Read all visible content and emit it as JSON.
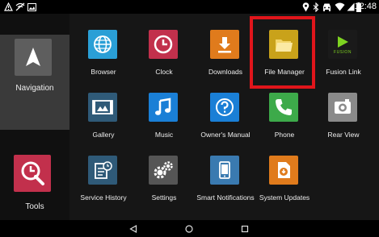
{
  "status_bar": {
    "time": "12:48",
    "left_icons": [
      "warning-icon",
      "no-signal-icon",
      "image-icon"
    ],
    "right_icons": [
      "location-icon",
      "bluetooth-icon",
      "car-icon",
      "wifi-icon",
      "signal-icon",
      "battery-icon"
    ]
  },
  "sidebar": {
    "navigation_label": "Navigation",
    "tools_label": "Tools"
  },
  "apps": {
    "browser": "Browser",
    "clock": "Clock",
    "downloads": "Downloads",
    "file_manager": "File Manager",
    "fusion_link": "Fusion Link",
    "fusion_logo": "FUSION",
    "gallery": "Gallery",
    "music": "Music",
    "owners_manual": "Owner's Manual",
    "phone": "Phone",
    "rear_view": "Rear View",
    "service_history": "Service History",
    "settings": "Settings",
    "smart_notifications": "Smart Notifications",
    "system_updates": "System Updates"
  },
  "colors": {
    "highlight": "#e0151b",
    "browser": "#2a9fd6",
    "clock": "#c2304c",
    "downloads": "#e07b1c",
    "file_manager": "#c9a21a",
    "music": "#1a7fd6",
    "phone": "#3daa4a",
    "system_updates": "#e07b1c"
  },
  "navigation_bar": [
    "back-icon",
    "home-icon",
    "recents-icon"
  ]
}
